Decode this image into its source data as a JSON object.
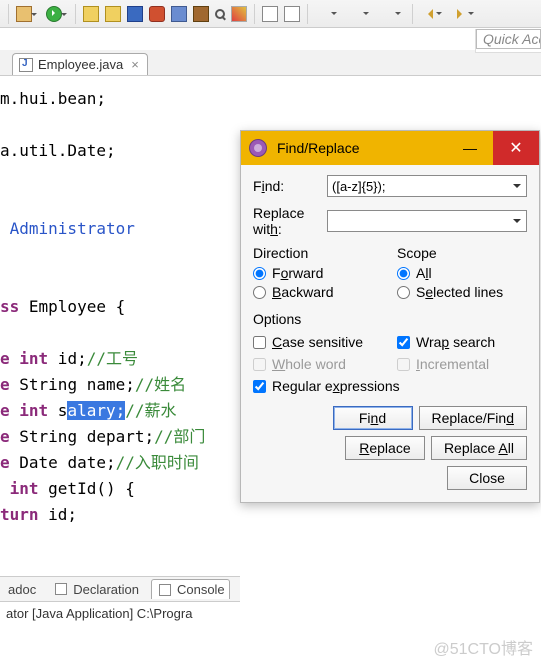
{
  "quick_access_placeholder": "Quick Access",
  "editor_tab": {
    "label": "Employee.java",
    "close": "×"
  },
  "code": {
    "line1a": "m.hui.bean;",
    "line2a": "a.util.Date;",
    "author": " Administrator",
    "classdecl_a": "ss",
    "classdecl_b": " Employee {",
    "f1_kw": "e",
    "f1_type": " int",
    "f1_rest": " id;",
    "f1_cmt": "//工号",
    "f2_kw": "e",
    "f2_rest": " String name;",
    "f2_cmt": "//姓名",
    "f3_kw": "e",
    "f3_type": " int",
    "f3_rest_a": " s",
    "f3_sel": "alary;",
    "f3_cmt": "//薪水",
    "f4_kw": "e",
    "f4_rest": " String depart;",
    "f4_cmt": "//部门",
    "f5_kw": "e",
    "f5_rest": " Date date;",
    "f5_cmt": "//入职时间",
    "m1_a": " int",
    "m1_b": " getId() {",
    "m2": "turn",
    "m2b": " id;"
  },
  "bottom": {
    "tab1": "adoc",
    "tab2": "Declaration",
    "tab3": "Console",
    "body": "ator [Java Application] C:\\Progra"
  },
  "dialog": {
    "title": "Find/Replace",
    "find_label_pre": "F",
    "find_label_u": "i",
    "find_label_post": "nd:",
    "find_value": "([a-z]{5});",
    "replace_label_pre": "Replace wit",
    "replace_label_u": "h",
    "replace_label_post": ":",
    "replace_value": "",
    "direction_title": "Direction",
    "forward_pre": "F",
    "forward_u": "o",
    "forward_post": "rward",
    "backward_u": "B",
    "backward_post": "ackward",
    "scope_title": "Scope",
    "all_pre": "A",
    "all_u": "l",
    "all_post": "l",
    "sel_pre": "S",
    "sel_u": "e",
    "sel_post": "lected lines",
    "options_title": "Options",
    "case_u": "C",
    "case_post": "ase sensitive",
    "wrap_pre": "Wra",
    "wrap_u": "p",
    "wrap_post": " search",
    "whole_u": "W",
    "whole_post": "hole word",
    "incr_u": "I",
    "incr_post": "ncremental",
    "regex_pre": "Regular e",
    "regex_u": "x",
    "regex_post": "pressions",
    "btn_find_pre": "Fi",
    "btn_find_u": "n",
    "btn_find_post": "d",
    "btn_rf": "Replace/Fin",
    "btn_rf_u": "d",
    "btn_replace_u": "R",
    "btn_replace_post": "eplace",
    "btn_ra_pre": "Replace ",
    "btn_ra_u": "A",
    "btn_ra_post": "ll",
    "btn_close": "Close"
  },
  "watermark": "@51CTO博客"
}
